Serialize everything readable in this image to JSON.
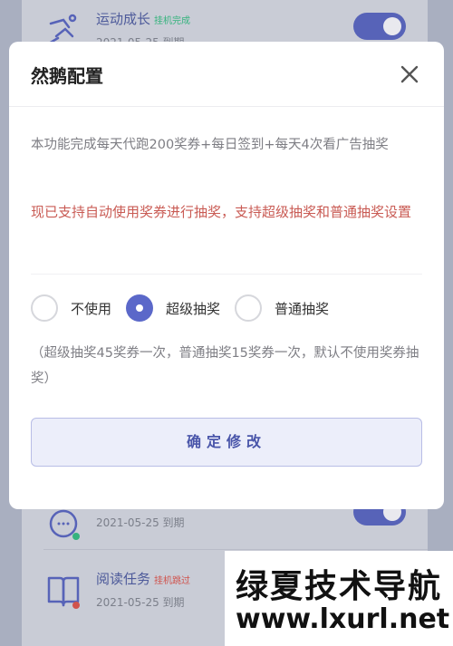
{
  "background": {
    "tasks": [
      {
        "title": "运动成长",
        "tag": "挂机完成",
        "date": "2021-05-25 到期"
      },
      {
        "title": "",
        "tag": "",
        "date": "2021-05-25 到期"
      },
      {
        "title": "阅读任务",
        "tag": "挂机跳过",
        "date": "2021-05-25 到期"
      }
    ],
    "colors": {
      "tag_complete": "#36b37e",
      "tag_skip": "#d0534d",
      "status_green": "#36b37e",
      "status_red": "#d0534d"
    }
  },
  "modal": {
    "title": "然鹅配置",
    "description": "本功能完成每天代跑200奖券+每日签到+每天4次看广告抽奖",
    "notice": "现已支持自动使用奖券进行抽奖，支持超级抽奖和普通抽奖设置",
    "options": [
      {
        "label": "不使用",
        "selected": false
      },
      {
        "label": "超级抽奖",
        "selected": true
      },
      {
        "label": "普通抽奖",
        "selected": false
      }
    ],
    "note": "（超级抽奖45奖券一次，普通抽奖15奖券一次，默认不使用奖券抽奖）",
    "confirm_label": "确定修改",
    "accent_color": "#5b68c9"
  },
  "watermark": {
    "line1": "绿夏技术导航",
    "line2": "www.lxurl.net"
  }
}
